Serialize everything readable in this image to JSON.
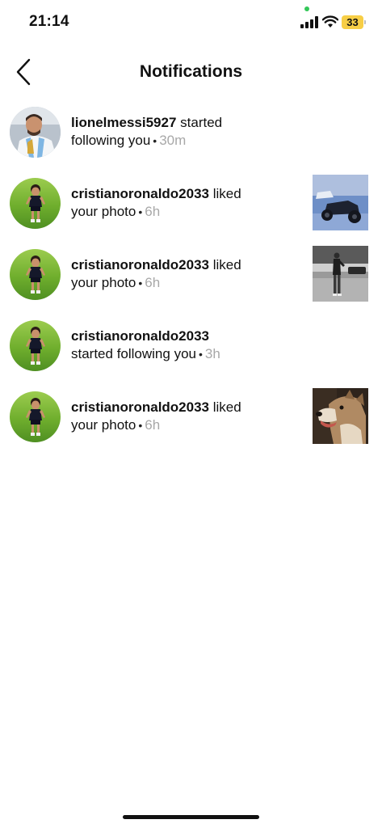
{
  "status_bar": {
    "time": "21:14",
    "battery": "33"
  },
  "header": {
    "title": "Notifications"
  },
  "notifications": [
    {
      "username": "lionelmessi5927",
      "action": "started",
      "action_line2": "following you",
      "time": "30m",
      "has_post": false
    },
    {
      "username": "cristianoronaldo2033",
      "action": "liked",
      "action_line2": "your photo",
      "time": "6h",
      "has_post": true,
      "post": "atv-photo"
    },
    {
      "username": "cristianoronaldo2033",
      "action": "liked",
      "action_line2": "your photo",
      "time": "6h",
      "has_post": true,
      "post": "street-photo"
    },
    {
      "username": "cristianoronaldo2033",
      "action": "",
      "action_line2": "started following you",
      "time": "3h",
      "has_post": false
    },
    {
      "username": "cristianoronaldo2033",
      "action": "liked",
      "action_line2": "your photo",
      "time": "6h",
      "has_post": true,
      "post": "dog-photo"
    }
  ],
  "colors": {
    "accent_battery": "#f7ce46",
    "time_gray": "#a8a8a8",
    "text": "#111111"
  }
}
